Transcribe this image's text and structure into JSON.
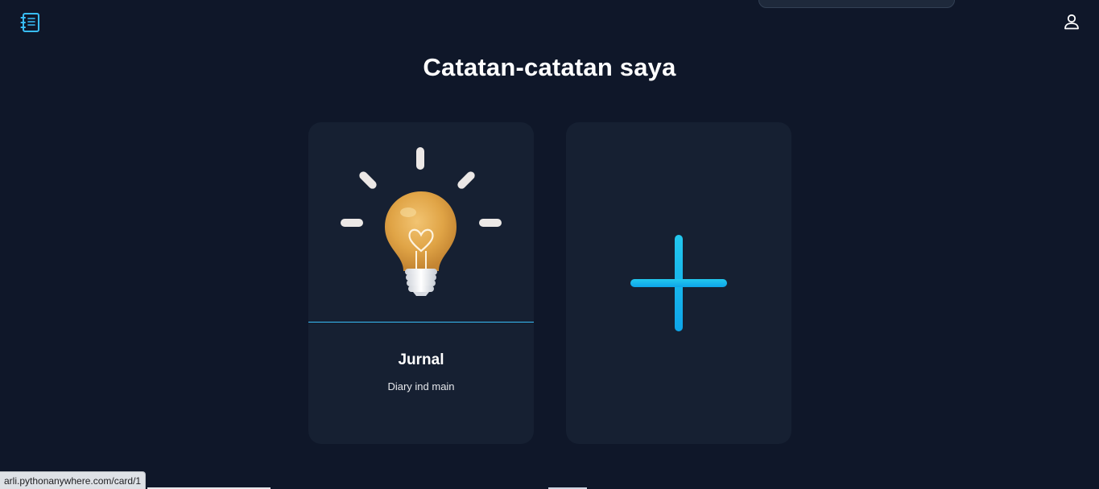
{
  "header": {
    "logo_icon": "notebook-icon",
    "user_icon": "user-icon",
    "accent_color": "#38bdf8"
  },
  "main": {
    "title": "Catatan-catatan saya",
    "cards": [
      {
        "title": "Jurnal",
        "description": "Diary ind main",
        "image_icon": "lightbulb-icon"
      }
    ],
    "add_card": {
      "icon": "plus-icon"
    }
  },
  "status_bar": {
    "url": "arli.pythonanywhere.com/card/1"
  }
}
